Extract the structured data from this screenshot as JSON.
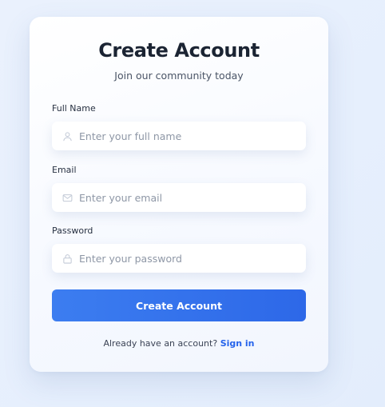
{
  "form": {
    "title": "Create Account",
    "subtitle": "Join our community today",
    "fields": [
      {
        "label": "Full Name",
        "placeholder": "Enter your full name",
        "value": "",
        "icon": "user-icon"
      },
      {
        "label": "Email",
        "placeholder": "Enter your email",
        "value": "",
        "icon": "mail-icon"
      },
      {
        "label": "Password",
        "placeholder": "Enter your password",
        "value": "",
        "icon": "lock-icon"
      }
    ],
    "submit_label": "Create Account",
    "footer_text": "Already have an account?",
    "signin_link": "Sign in"
  },
  "colors": {
    "accent": "#2d68e8",
    "link": "#2563eb",
    "background": "#e6effd",
    "title": "#1b2433",
    "placeholder": "#8e97a6",
    "icon": "#c2c9d6"
  }
}
